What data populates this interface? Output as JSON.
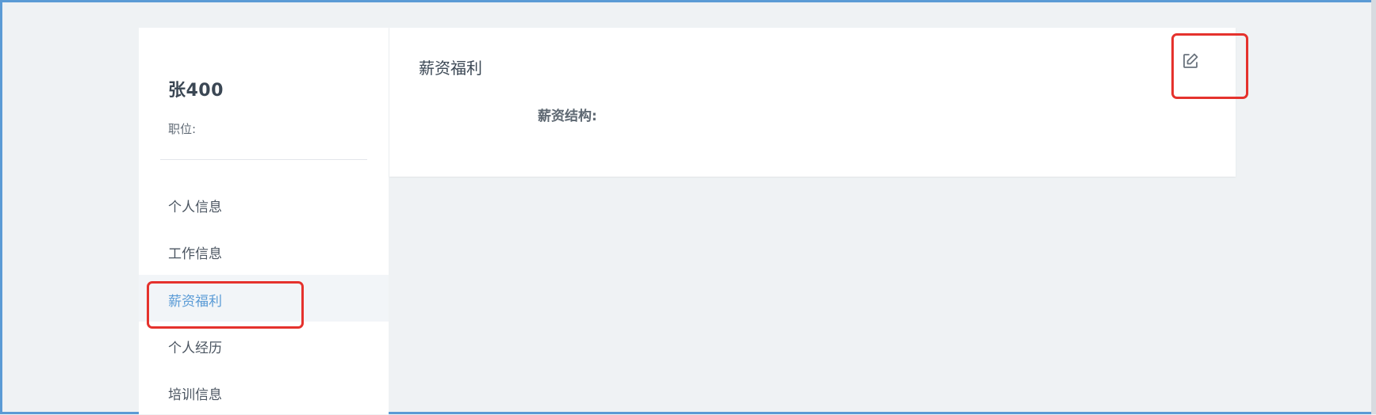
{
  "sidebar": {
    "user_name": "张400",
    "position_label": "职位:",
    "nav_items": [
      {
        "label": "个人信息",
        "active": false
      },
      {
        "label": "工作信息",
        "active": false
      },
      {
        "label": "薪资福利",
        "active": true
      },
      {
        "label": "个人经历",
        "active": false
      },
      {
        "label": "培训信息",
        "active": false
      }
    ]
  },
  "main": {
    "section_title": "薪资福利",
    "fields": [
      {
        "label": "薪资结构:"
      }
    ]
  },
  "icons": {
    "edit": "edit-icon"
  },
  "colors": {
    "accent": "#5a9bd6",
    "annotation": "#e5322d",
    "page_bg": "#eff2f4"
  }
}
